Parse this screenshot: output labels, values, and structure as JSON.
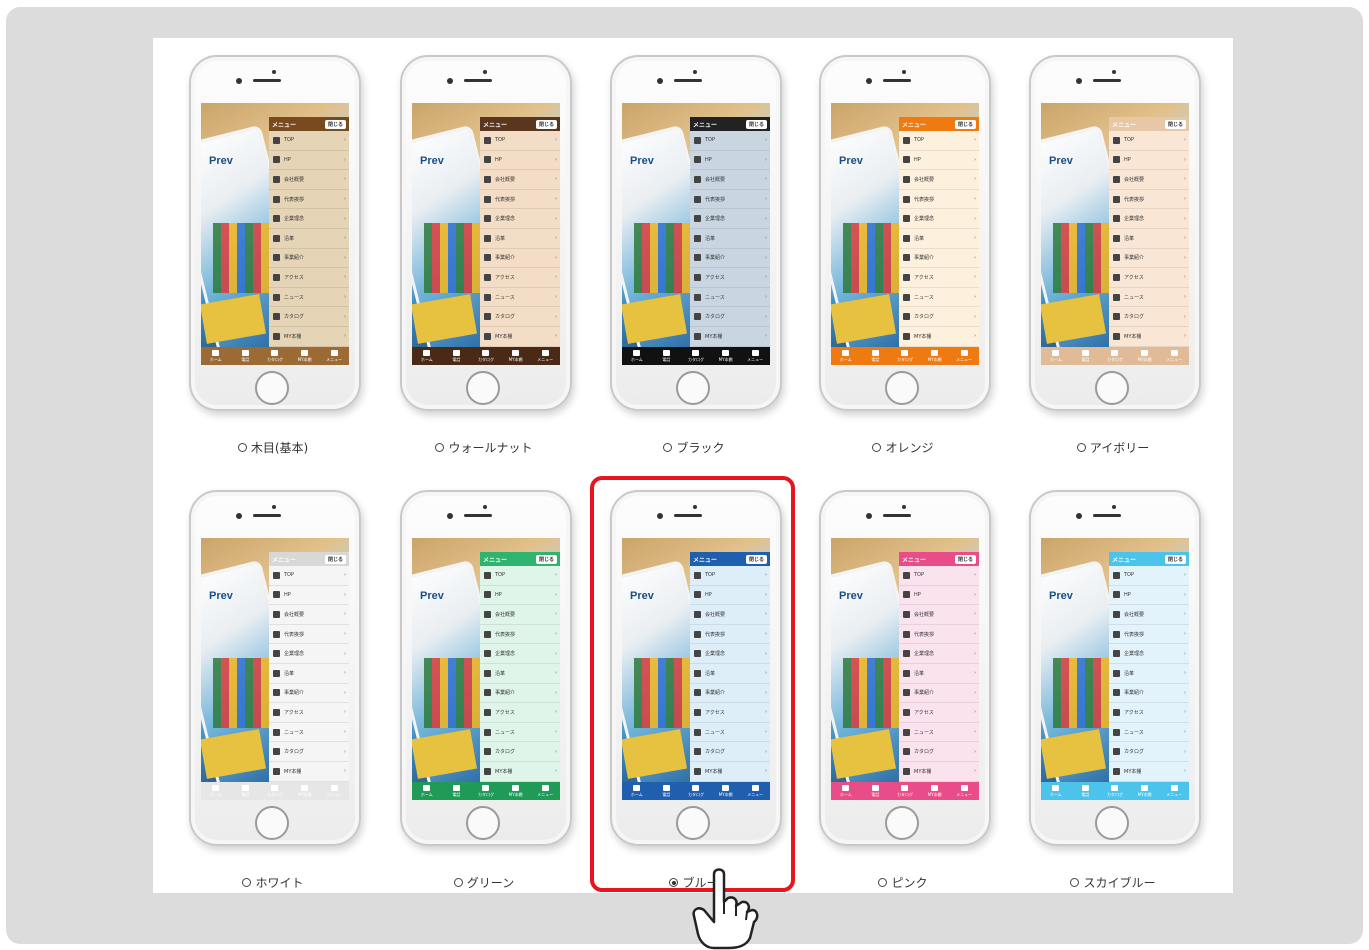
{
  "menu": {
    "header_label": "メニュー",
    "close_label": "閉じる",
    "items": [
      "TOP",
      "HP",
      "会社概要",
      "代表挨拶",
      "企業理念",
      "沿革",
      "事業紹介",
      "アクセス",
      "ニュース",
      "カタログ",
      "MY本棚"
    ]
  },
  "tabbar": {
    "items": [
      "ホーム",
      "電話",
      "カタログ",
      "MY本棚",
      "メニュー"
    ]
  },
  "screen_text": "Prev",
  "themes": [
    {
      "label": "木目(基本)",
      "selected": false,
      "menu_bg": "#e5d4b5",
      "header_bg": "#7a4a1f",
      "header_text": "#ffffff",
      "tab_bg": "#9b6a35",
      "row": 0,
      "col": 0
    },
    {
      "label": "ウォールナット",
      "selected": false,
      "menu_bg": "#f4ddc6",
      "header_bg": "#5a3520",
      "header_text": "#ffffff",
      "tab_bg": "#4a2a17",
      "row": 0,
      "col": 1
    },
    {
      "label": "ブラック",
      "selected": false,
      "menu_bg": "#c9d6e2",
      "header_bg": "#222222",
      "header_text": "#ffffff",
      "tab_bg": "#111111",
      "row": 0,
      "col": 2
    },
    {
      "label": "オレンジ",
      "selected": false,
      "menu_bg": "#fdf0dd",
      "header_bg": "#f07a12",
      "header_text": "#ffffff",
      "tab_bg": "#f07a12",
      "row": 0,
      "col": 3
    },
    {
      "label": "アイボリー",
      "selected": false,
      "menu_bg": "#f9e6d5",
      "header_bg": "#e8c7a6",
      "header_text": "#ffffff",
      "tab_bg": "#e1bb98",
      "row": 0,
      "col": 4
    },
    {
      "label": "ホワイト",
      "selected": false,
      "menu_bg": "#f5f5f5",
      "header_bg": "#d8d8d8",
      "header_text": "#ffffff",
      "tab_bg": "#e6e6e6",
      "row": 1,
      "col": 0
    },
    {
      "label": "グリーン",
      "selected": false,
      "menu_bg": "#e0f5ea",
      "header_bg": "#2fb36e",
      "header_text": "#ffffff",
      "tab_bg": "#1f9a57",
      "row": 1,
      "col": 1
    },
    {
      "label": "ブルー",
      "selected": true,
      "menu_bg": "#deeef9",
      "header_bg": "#1f5fae",
      "header_text": "#ffffff",
      "tab_bg": "#1f5fae",
      "row": 1,
      "col": 2
    },
    {
      "label": "ピンク",
      "selected": false,
      "menu_bg": "#fbe3ee",
      "header_bg": "#e84d8a",
      "header_text": "#ffffff",
      "tab_bg": "#e84d8a",
      "row": 1,
      "col": 3
    },
    {
      "label": "スカイブルー",
      "selected": false,
      "menu_bg": "#e3f3fb",
      "header_bg": "#4cc3ea",
      "header_text": "#ffffff",
      "tab_bg": "#4cc3ea",
      "row": 1,
      "col": 4
    }
  ],
  "colors": {
    "highlight_border": "#e8141e",
    "background": "#dcdcdc"
  },
  "icons": {
    "pointer": "pointing-hand-icon"
  }
}
